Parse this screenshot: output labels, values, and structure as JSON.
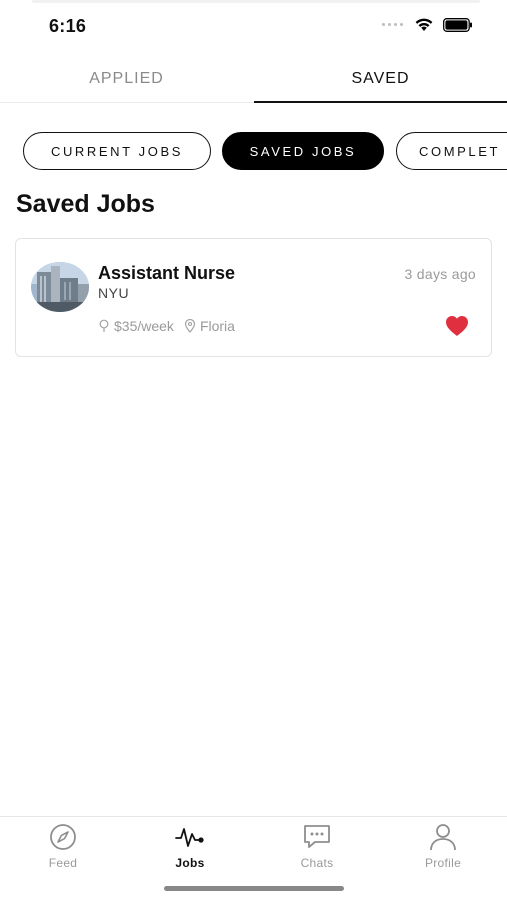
{
  "status_bar": {
    "time": "6:16"
  },
  "top_tabs": {
    "applied": "APPLIED",
    "saved": "SAVED"
  },
  "filters": {
    "current": "CURRENT JOBS",
    "saved": "SAVED JOBS",
    "completed": "COMPLET"
  },
  "section_title": "Saved Jobs",
  "job": {
    "title": "Assistant Nurse",
    "company": "NYU",
    "posted": "3 days ago",
    "pay": "$35/week",
    "location": "Floria",
    "saved": true,
    "heart_color": "#e0303f"
  },
  "nav": {
    "feed": "Feed",
    "jobs": "Jobs",
    "chats": "Chats",
    "profile": "Profile",
    "active": "jobs"
  },
  "colors": {
    "accent": "#000000",
    "muted": "#9a9a9a"
  }
}
